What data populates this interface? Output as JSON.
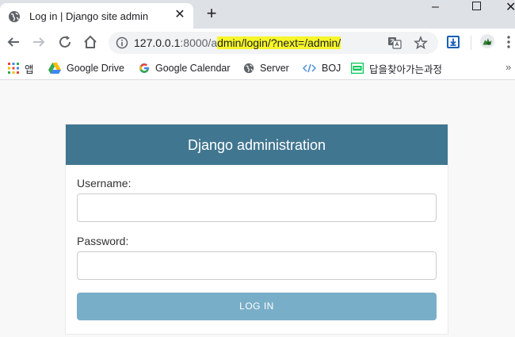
{
  "browser": {
    "tab": {
      "title": "Log in | Django site admin",
      "close": "✕"
    },
    "new_tab": "+",
    "window": {
      "minimize": "–",
      "maximize": "",
      "close": "✕"
    },
    "url": {
      "host": "127.0.0.1",
      "port_path_plain": ":8000/a",
      "path_highlighted": "dmin/login/?next=/admin/"
    },
    "bookmarks": [
      {
        "label": "앱",
        "icon": "apps-grid-icon"
      },
      {
        "label": "Google Drive",
        "icon": "google-drive-icon"
      },
      {
        "label": "Google Calendar",
        "icon": "google-g-icon"
      },
      {
        "label": "Server",
        "icon": "globe-icon"
      },
      {
        "label": "BOJ",
        "icon": "code-brackets-icon"
      },
      {
        "label": "답을찾아가는과정",
        "icon": "blog-icon"
      }
    ],
    "bookmarks_overflow": "»",
    "colors": {
      "highlight": "#f6f62a",
      "tabstrip": "#dee1e6"
    }
  },
  "login": {
    "header": "Django administration",
    "username_label": "Username:",
    "username_value": "",
    "password_label": "Password:",
    "password_value": "",
    "submit_label": "LOG IN",
    "colors": {
      "header_bg": "#417690",
      "button_bg": "#79aec8"
    }
  }
}
